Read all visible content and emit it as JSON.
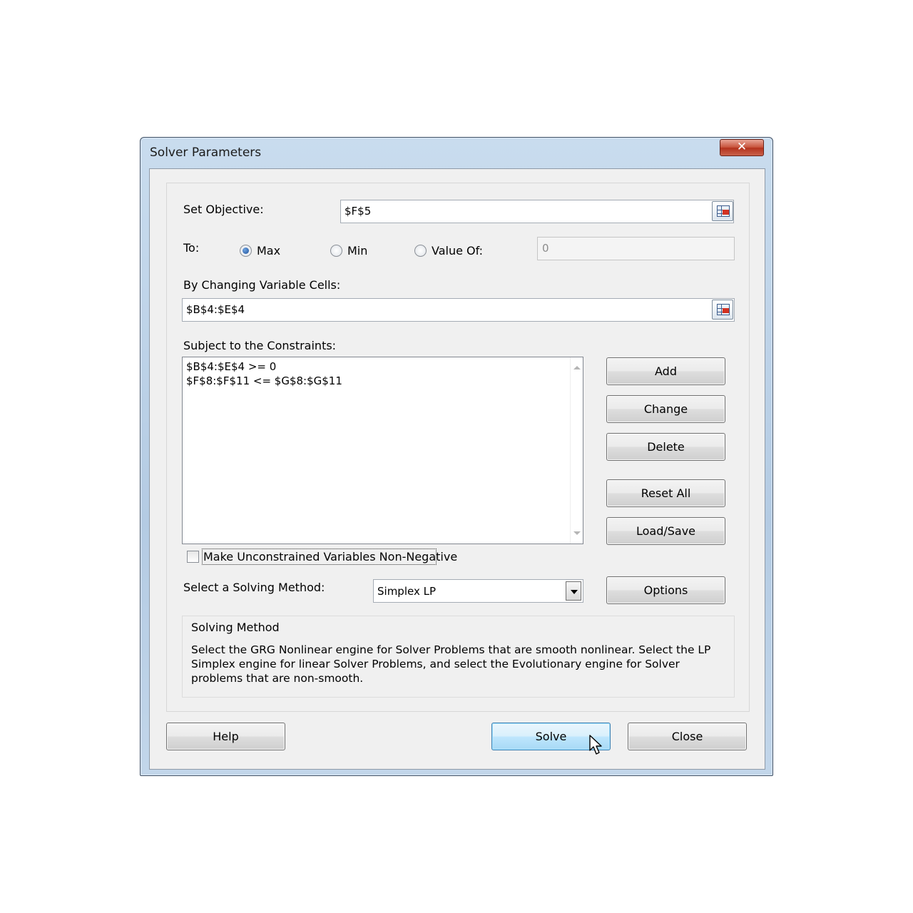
{
  "window": {
    "title": "Solver Parameters",
    "close_glyph": "✕"
  },
  "objective": {
    "label": "Set Objective:",
    "value": "$F$5"
  },
  "to": {
    "label": "To:",
    "options": [
      "Max",
      "Min",
      "Value Of:"
    ],
    "selected": "Max",
    "value_of": "0"
  },
  "changing": {
    "label": "By Changing Variable Cells:",
    "value": "$B$4:$E$4"
  },
  "constraints": {
    "label": "Subject to the Constraints:",
    "items": [
      "$B$4:$E$4 >= 0",
      "$F$8:$F$11 <= $G$8:$G$11"
    ]
  },
  "side_buttons": {
    "add": "Add",
    "change": "Change",
    "delete": "Delete",
    "reset_all": "Reset All",
    "load_save": "Load/Save",
    "options": "Options"
  },
  "nonneg": {
    "label": "Make Unconstrained Variables Non-Negative",
    "checked": false
  },
  "method": {
    "label": "Select a Solving Method:",
    "value": "Simplex LP"
  },
  "solving_method": {
    "title": "Solving Method",
    "description": "Select the GRG Nonlinear engine for Solver Problems that are smooth nonlinear. Select the LP Simplex engine for linear Solver Problems, and select the Evolutionary engine for Solver problems that are non-smooth."
  },
  "footer": {
    "help": "Help",
    "solve": "Solve",
    "close": "Close"
  },
  "icons": [
    "range-selector-icon",
    "close-icon",
    "dropdown-arrow-icon",
    "mouse-pointer-icon"
  ],
  "colors": {
    "title_bar": "#c9dcee",
    "close_button": "#c8533c",
    "default_button": "#bee6fd"
  }
}
